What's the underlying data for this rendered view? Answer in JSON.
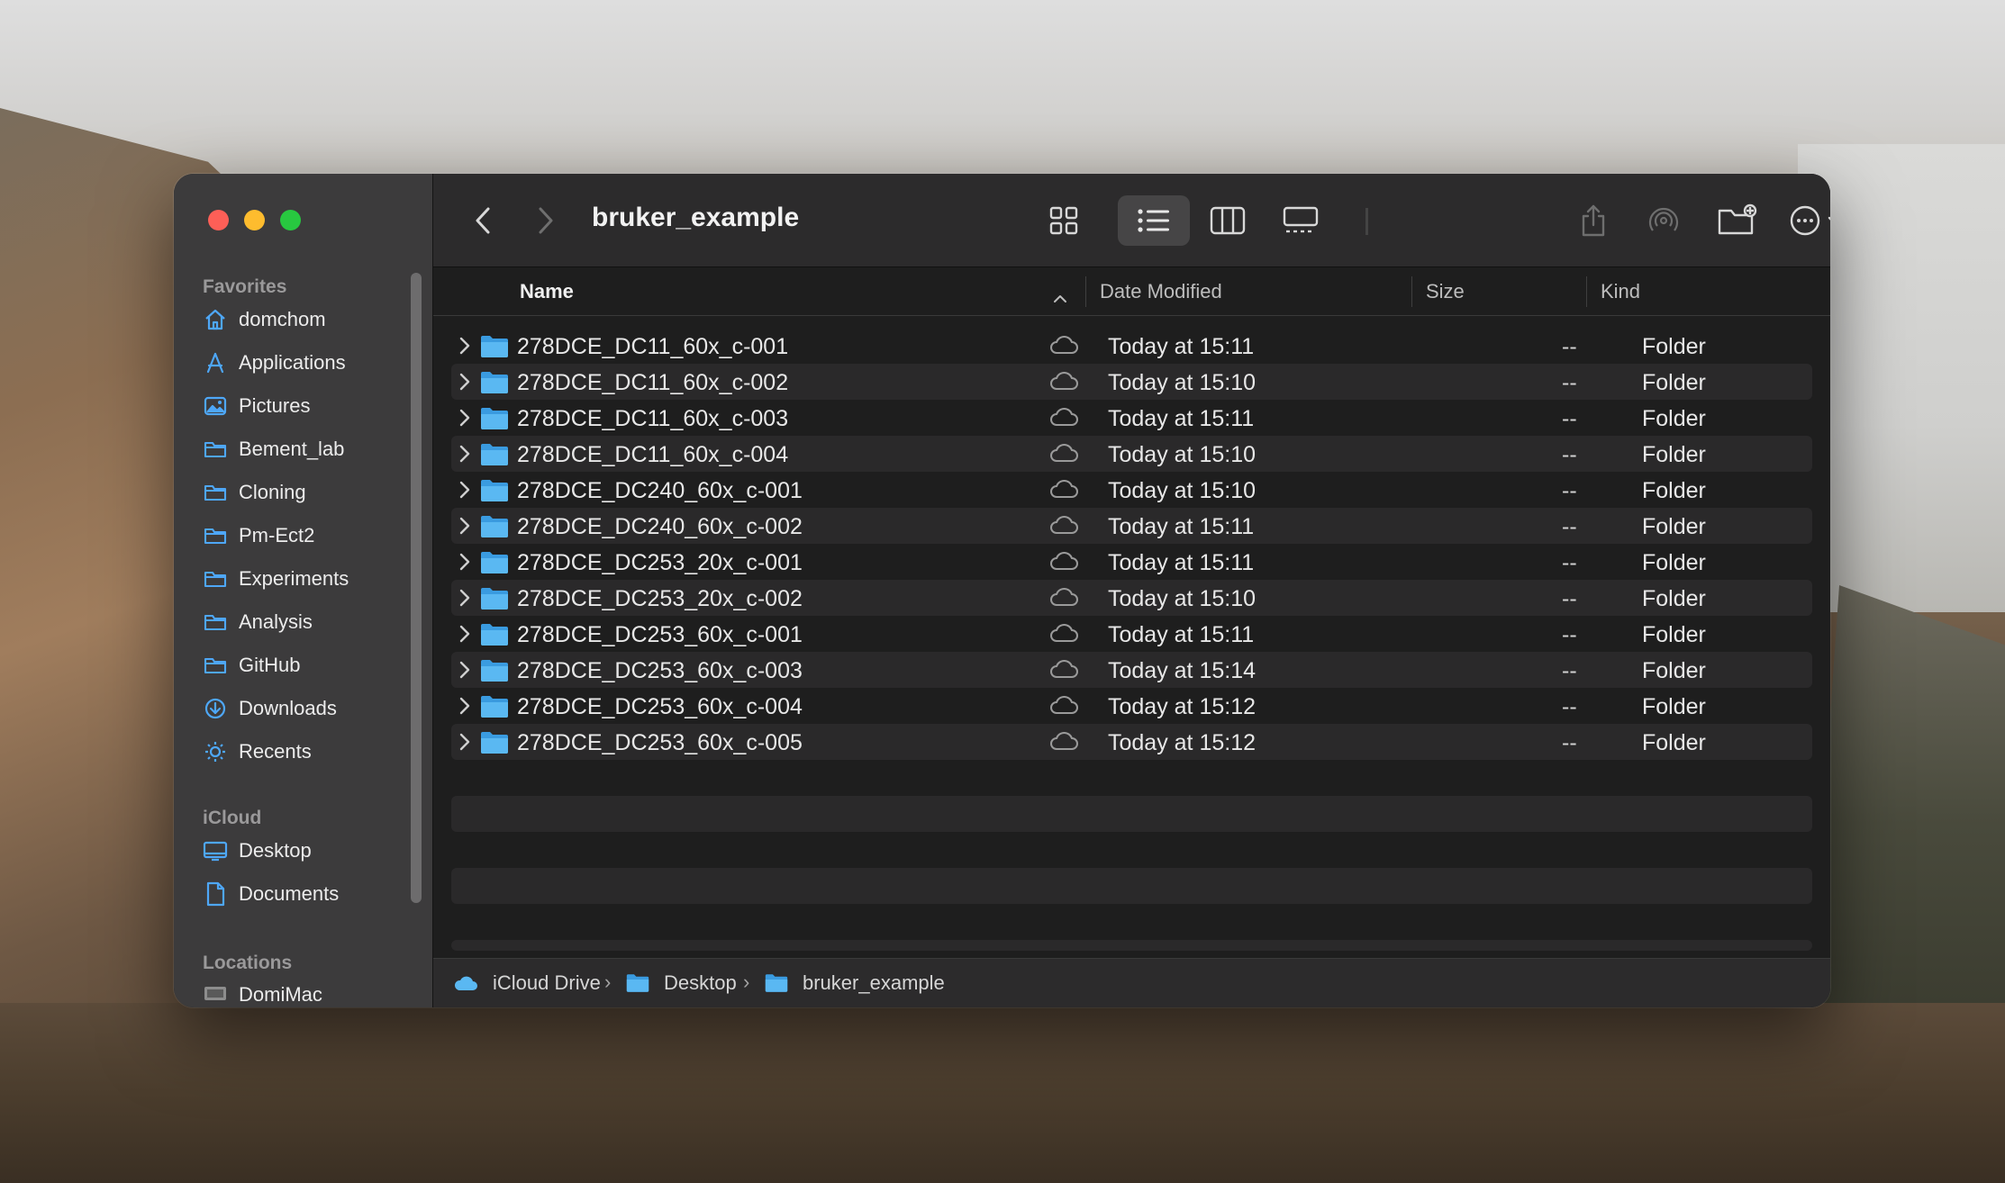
{
  "window": {
    "title": "bruker_example"
  },
  "sidebar": {
    "favorites_label": "Favorites",
    "favorites": [
      {
        "label": "domchom",
        "icon": "home-icon"
      },
      {
        "label": "Applications",
        "icon": "applications-icon"
      },
      {
        "label": "Pictures",
        "icon": "pictures-icon"
      },
      {
        "label": "Bement_lab",
        "icon": "folder-icon"
      },
      {
        "label": "Cloning",
        "icon": "folder-icon"
      },
      {
        "label": "Pm-Ect2",
        "icon": "folder-icon"
      },
      {
        "label": "Experiments",
        "icon": "folder-icon"
      },
      {
        "label": "Analysis",
        "icon": "folder-icon"
      },
      {
        "label": "GitHub",
        "icon": "folder-icon"
      },
      {
        "label": "Downloads",
        "icon": "downloads-icon"
      },
      {
        "label": "Recents",
        "icon": "recents-icon"
      }
    ],
    "icloud_label": "iCloud",
    "icloud": [
      {
        "label": "Desktop",
        "icon": "desktop-icon"
      },
      {
        "label": "Documents",
        "icon": "document-icon"
      }
    ],
    "locations_label": "Locations",
    "locations": [
      {
        "label": "DomiMac",
        "icon": "computer-icon"
      }
    ]
  },
  "columns": {
    "name": "Name",
    "date": "Date Modified",
    "size": "Size",
    "kind": "Kind"
  },
  "files": [
    {
      "name": "278DCE_DC11_60x_c-001",
      "date": "Today at 15:11",
      "size": "--",
      "kind": "Folder"
    },
    {
      "name": "278DCE_DC11_60x_c-002",
      "date": "Today at 15:10",
      "size": "--",
      "kind": "Folder"
    },
    {
      "name": "278DCE_DC11_60x_c-003",
      "date": "Today at 15:11",
      "size": "--",
      "kind": "Folder"
    },
    {
      "name": "278DCE_DC11_60x_c-004",
      "date": "Today at 15:10",
      "size": "--",
      "kind": "Folder"
    },
    {
      "name": "278DCE_DC240_60x_c-001",
      "date": "Today at 15:10",
      "size": "--",
      "kind": "Folder"
    },
    {
      "name": "278DCE_DC240_60x_c-002",
      "date": "Today at 15:11",
      "size": "--",
      "kind": "Folder"
    },
    {
      "name": "278DCE_DC253_20x_c-001",
      "date": "Today at 15:11",
      "size": "--",
      "kind": "Folder"
    },
    {
      "name": "278DCE_DC253_20x_c-002",
      "date": "Today at 15:10",
      "size": "--",
      "kind": "Folder"
    },
    {
      "name": "278DCE_DC253_60x_c-001",
      "date": "Today at 15:11",
      "size": "--",
      "kind": "Folder"
    },
    {
      "name": "278DCE_DC253_60x_c-003",
      "date": "Today at 15:14",
      "size": "--",
      "kind": "Folder"
    },
    {
      "name": "278DCE_DC253_60x_c-004",
      "date": "Today at 15:12",
      "size": "--",
      "kind": "Folder"
    },
    {
      "name": "278DCE_DC253_60x_c-005",
      "date": "Today at 15:12",
      "size": "--",
      "kind": "Folder"
    }
  ],
  "pathbar": [
    {
      "label": "iCloud Drive",
      "icon": "icloud-icon"
    },
    {
      "label": "Desktop",
      "icon": "folder-icon"
    },
    {
      "label": "bruker_example",
      "icon": "folder-icon"
    }
  ],
  "colors": {
    "folder": "#4fb3f0",
    "accent": "#1e8cf0",
    "sidebar": "#3c3b3c",
    "content": "#1e1e1e"
  }
}
